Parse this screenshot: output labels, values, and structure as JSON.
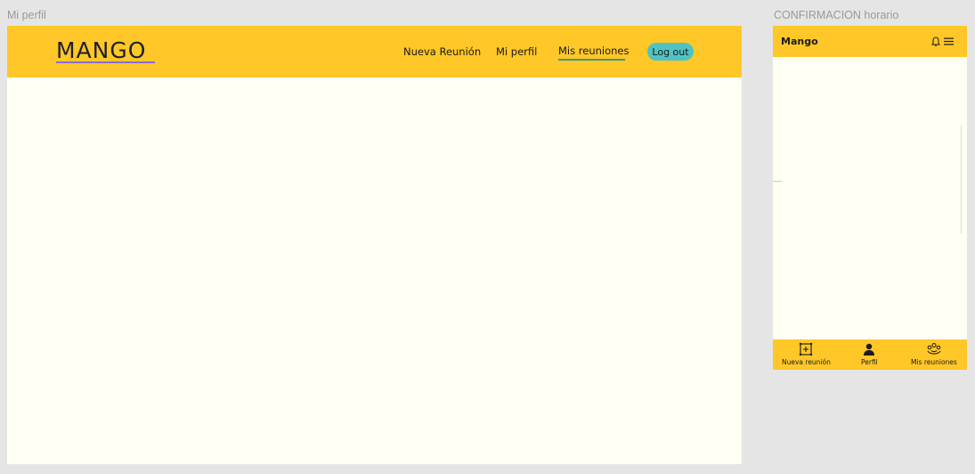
{
  "frames": {
    "desktop_label": "Mi perfil",
    "mobile_label": "CONFIRMACION horario"
  },
  "desktop": {
    "logo": "MANGO",
    "nav": {
      "nueva": "Nueva Reunión",
      "perfil": "Mi perfil",
      "reuniones": "Mis reuniones",
      "active": "Mis reuniones"
    },
    "logout": "Log out"
  },
  "mobile": {
    "title": "Mango",
    "header_icons": [
      "bell-icon",
      "menu-icon"
    ],
    "tabs": [
      {
        "label": "Nueva reunión",
        "icon": "add-square-icon"
      },
      {
        "label": "Perfil",
        "icon": "person-icon"
      },
      {
        "label": "Mis reuniones",
        "icon": "group-icon"
      }
    ]
  },
  "colors": {
    "accent": "#ffc727",
    "background": "#fffff3",
    "canvas": "#e5e5e5",
    "logout_button": "#4fc3c4",
    "active_underline": "#3a9b7a",
    "logo_underline": "#8a6bd6"
  }
}
